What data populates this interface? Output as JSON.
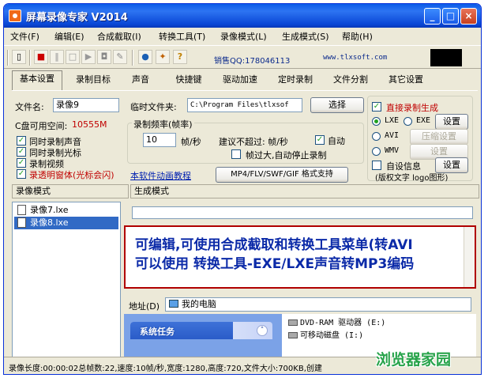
{
  "window": {
    "title": "屏幕录像专家  V2014",
    "min_label": "_",
    "max_label": "□",
    "close_label": "×"
  },
  "menu": [
    {
      "label": "文件(F)"
    },
    {
      "label": "编辑(E)"
    },
    {
      "label": "合成截取(I)"
    },
    {
      "label": "转换工具(T)"
    },
    {
      "label": "录像模式(L)"
    },
    {
      "label": "生成模式(S)"
    },
    {
      "label": "帮助(H)"
    }
  ],
  "toolbar": {
    "sales": "销售QQ:178046113",
    "site": "www.tlxsoft.com",
    "help_icon_label": "?"
  },
  "tabs": [
    {
      "label": "基本设置"
    },
    {
      "label": "录制目标"
    },
    {
      "label": "声音"
    },
    {
      "label": "快捷键"
    },
    {
      "label": "驱动加速"
    },
    {
      "label": "定时录制"
    },
    {
      "label": "文件分割"
    },
    {
      "label": "其它设置"
    }
  ],
  "basic": {
    "filename_label": "文件名:",
    "filename_value": "录像9",
    "free_space_label": "C盘可用空间:",
    "free_space_value": "10555M",
    "temp_folder_label": "临时文件夹:",
    "temp_folder_value": "C:\\Program Files\\tlxsof",
    "choose_button": "选择",
    "record_sound": "同时录制声音",
    "record_cursor": "同时录制光标",
    "record_video": "录制视频",
    "record_transparent": "录透明窗体(光标会闪)",
    "framerate_group": "录制频率(帧率)",
    "framerate_value": "10",
    "framerate_unit": "帧/秒",
    "suggest_text": "建议不超过: 帧/秒",
    "auto_label": "自动",
    "auto_stop_label": "帧过大,自动停止录制",
    "tutorial_link": "本软件动画教程",
    "formats_button": "MP4/FLV/SWF/GIF  格式支持"
  },
  "output": {
    "direct_record": "直接录制生成",
    "lxe_label": "LXE",
    "exe_label": "EXE",
    "settings1": "设置",
    "avi_label": "AVI",
    "compress_settings": "压缩设置",
    "wmv_label": "WMV",
    "settings2": "设置",
    "self_info": "自设信息",
    "settings3": "设置",
    "copyright_note": "(版权文字 logo图形)"
  },
  "subtabs": {
    "record_mode": "录像模式",
    "generate_mode": "生成模式"
  },
  "files": [
    {
      "name": "录像7.lxe",
      "selected": false
    },
    {
      "name": "录像8.lxe",
      "selected": true
    }
  ],
  "banner": {
    "line1": "可编辑,可使用合成截取和转换工具菜单(转AVI",
    "line2": "可以使用 转换工具-EXE/LXE声音转MP3编码"
  },
  "browser": {
    "address_label": "地址(D)",
    "address_value": "我的电脑",
    "tasks_label": "系统任务",
    "drives": [
      {
        "label": "DVD-RAM 驱动器 (E:)"
      },
      {
        "label": "可移动磁盘 (I:)"
      }
    ]
  },
  "status": {
    "text": "录像长度:00:00:02总帧数:22,速度:10帧/秒,宽度:1280,高度:720,文件大小:700KB,创建"
  },
  "watermark": "浏览器家园"
}
